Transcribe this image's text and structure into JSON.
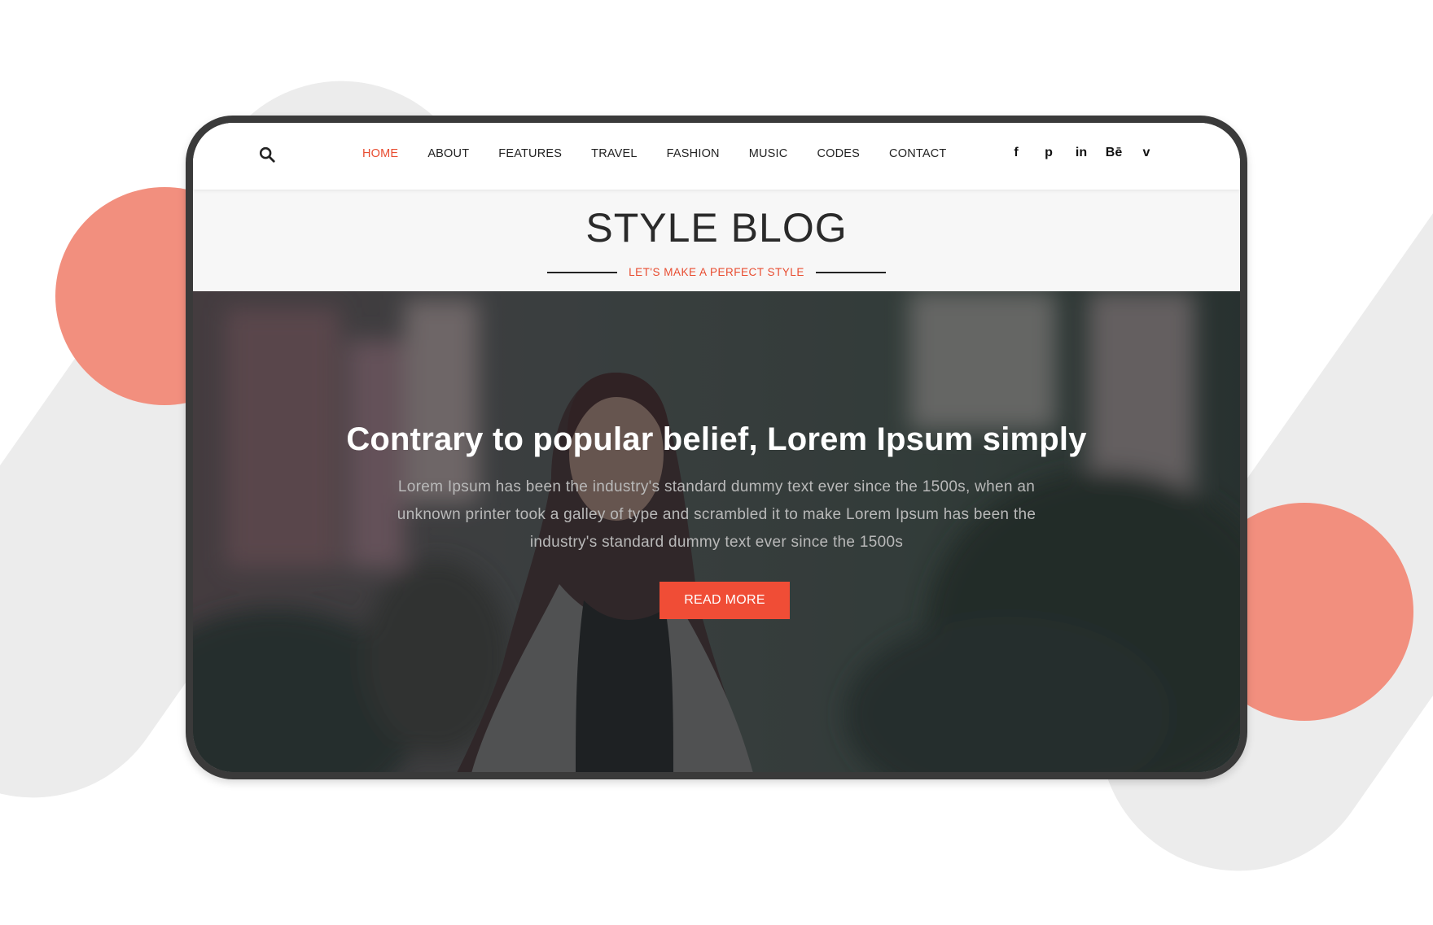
{
  "nav": {
    "items": [
      {
        "label": "HOME",
        "active": true
      },
      {
        "label": "ABOUT",
        "active": false
      },
      {
        "label": "FEATURES",
        "active": false
      },
      {
        "label": "TRAVEL",
        "active": false
      },
      {
        "label": "FASHION",
        "active": false
      },
      {
        "label": "MUSIC",
        "active": false
      },
      {
        "label": "CODES",
        "active": false
      },
      {
        "label": "CONTACT",
        "active": false
      }
    ],
    "search_icon": "search-icon",
    "social": [
      {
        "icon": "facebook-icon",
        "glyph": "f"
      },
      {
        "icon": "pinterest-icon",
        "glyph": "p"
      },
      {
        "icon": "linkedin-icon",
        "glyph": "in"
      },
      {
        "icon": "behance-icon",
        "glyph": "Bē"
      },
      {
        "icon": "vimeo-icon",
        "glyph": "v"
      }
    ]
  },
  "header": {
    "title": "STYLE BLOG",
    "tagline": "LET'S MAKE A PERFECT STYLE"
  },
  "hero": {
    "title": "Contrary to popular belief, Lorem Ipsum simply",
    "text": "Lorem Ipsum has been the industry's standard dummy text ever since the 1500s, when an unknown printer took a galley of type and scrambled it to make Lorem Ipsum has been the industry's standard dummy text ever since the 1500s",
    "button_label": "READ MORE"
  },
  "colors": {
    "accent": "#e84c30",
    "button": "#f04d36",
    "decor_circle": "#f28f7e",
    "device_frame": "#3a3a3a"
  }
}
